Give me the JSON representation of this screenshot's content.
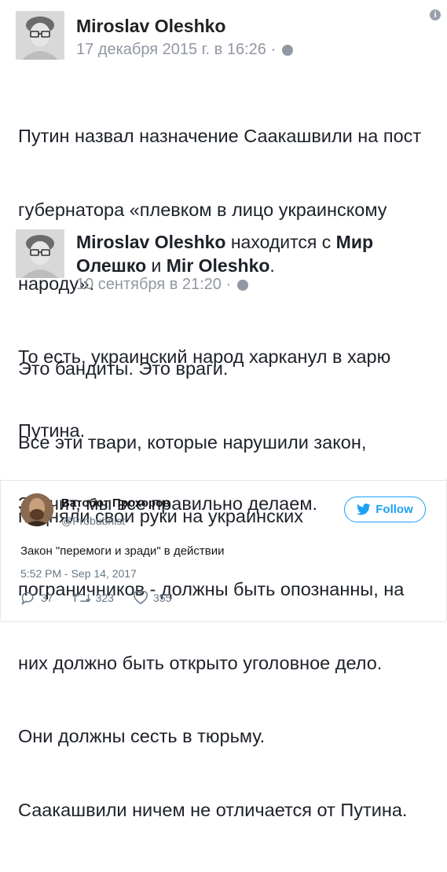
{
  "fb_post": {
    "author": "Miroslav Oleshko",
    "timestamp": "17 декабря 2015 г. в 16:26 ·",
    "body_lines": [
      "Путин назвал назначение Саакашвили на пост",
      "губернатора «плевком в лицо украинскому",
      "народу».",
      "То есть, украинский народ харканул в харю",
      "Путина.",
      "Значит, мы все правильно делаем."
    ]
  },
  "fb_shared": {
    "author": "Miroslav Oleshko",
    "with_text": "находится с",
    "tagged_1": "Мир",
    "tagged_1b": "Олешко",
    "and_text": "и",
    "tagged_2": "Mir Oleshko",
    "period": ".",
    "timestamp": "10 сентября в 21:20 ·",
    "body_lines": [
      "Это бандиты. Это враги.",
      "Все эти твари, которые нарушили закон,",
      "подняли свои руки на украинских",
      "пограничников - должны быть опознанны, на",
      "них должно быть открыто уголовное дело.",
      "Они должны сесть в тюрьму.",
      "Саакашвили ничем не отличается от Путина."
    ]
  },
  "tweet": {
    "display_name": "Ватобот Прохоров",
    "handle": "@Probubnist",
    "follow_label": "Follow",
    "text": "Закон \"перемоги и зради\" в действии",
    "time": "5:52 PM - Sep 14, 2017",
    "replies": "37",
    "retweets": "323",
    "likes": "355",
    "accent_color": "#1da1f2"
  }
}
